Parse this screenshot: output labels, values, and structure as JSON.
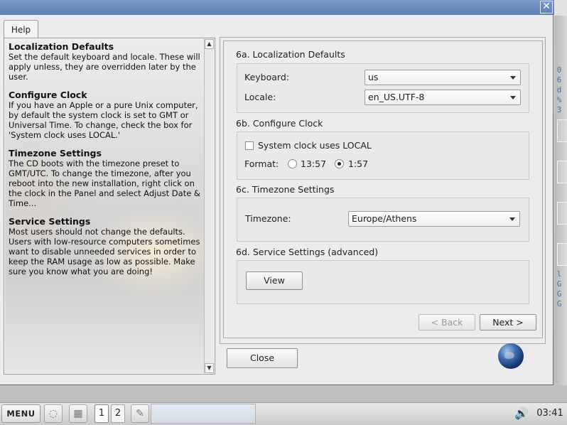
{
  "help_tab": {
    "label": "Help"
  },
  "help": {
    "sections": [
      {
        "title": "Localization Defaults",
        "body": "Set the default keyboard and locale. These will apply unless, they are overridden later by the user."
      },
      {
        "title": "Configure Clock",
        "body": "If you have an Apple or a pure Unix computer, by default the system clock is set to GMT or Universal Time. To change, check the box for 'System clock uses LOCAL.'"
      },
      {
        "title": "Timezone Settings",
        "body": "The CD boots with the timezone preset to GMT/UTC. To change the timezone, after you reboot into the new installation, right click on the clock in the Panel and select Adjust Date & Time..."
      },
      {
        "title": "Service Settings",
        "body": "Most users should not change the defaults. Users with low-resource computers sometimes want to disable unneeded services in order to keep the RAM usage as low as possible. Make sure you know what you are doing!"
      }
    ]
  },
  "localization": {
    "title": "6a. Localization Defaults",
    "keyboard_label": "Keyboard:",
    "keyboard_value": "us",
    "locale_label": "Locale:",
    "locale_value": "en_US.UTF-8"
  },
  "clock": {
    "title": "6b. Configure Clock",
    "checkbox_label": "System clock uses LOCAL",
    "checkbox_checked": false,
    "format_label": "Format:",
    "format_options": [
      "13:57",
      "1:57"
    ],
    "format_selected": "1:57"
  },
  "timezone": {
    "title": "6c. Timezone Settings",
    "label": "Timezone:",
    "value": "Europe/Athens"
  },
  "services": {
    "title": "6d. Service Settings (advanced)",
    "view_button": "View"
  },
  "nav": {
    "back": "< Back",
    "next": "Next >",
    "close": "Close"
  },
  "window": {
    "close_glyph": "✕"
  },
  "desktop_fragments": [
    "0",
    "6",
    "d",
    "%",
    "3",
    "l",
    "G",
    "G",
    "G"
  ],
  "taskbar": {
    "menu_label": "MENU",
    "workspaces": [
      "1",
      "2"
    ],
    "active_workspace": "1",
    "volume_icon": "🔊",
    "clock": "03:41"
  },
  "colors": {
    "titlebar": "#6f8dc2",
    "window_bg": "#ececec",
    "desktop_text": "#4a6fa0"
  }
}
